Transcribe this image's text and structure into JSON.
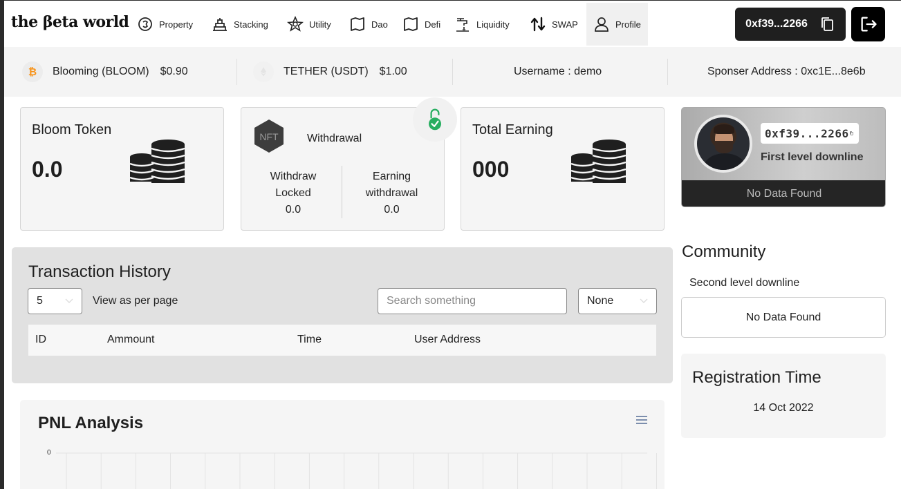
{
  "nav": {
    "logo": "the βeta world",
    "items": [
      {
        "label": "Property",
        "icon": "coin-stack-icon"
      },
      {
        "label": "Stacking",
        "icon": "bricks-icon"
      },
      {
        "label": "Utility",
        "icon": "star-network-icon"
      },
      {
        "label": "Dao",
        "icon": "map-icon"
      },
      {
        "label": "Defi",
        "icon": "map-icon"
      },
      {
        "label": "Liquidity",
        "icon": "faucet-icon"
      },
      {
        "label": "SWAP",
        "icon": "swap-arrows-icon"
      },
      {
        "label": "Profile",
        "icon": "user-icon"
      }
    ],
    "wallet_address": "0xf39...2266"
  },
  "ticker": {
    "bloom": {
      "name": "Blooming (BLOOM)",
      "price": "$0.90"
    },
    "usdt": {
      "name": "TETHER (USDT)",
      "price": "$1.00"
    },
    "username": "Username : demo",
    "sponsor": "Sponser Address : 0xc1E...8e6b"
  },
  "cards": {
    "bloom_token": {
      "title": "Bloom Token",
      "value": "0.0"
    },
    "withdrawal": {
      "badge": "NFT",
      "title": "Withdrawal",
      "locked_label_1": "Withdraw",
      "locked_label_2": "Locked",
      "locked_value": "0.0",
      "earning_label_1": "Earning",
      "earning_label_2": "withdrawal",
      "earning_value": "0.0"
    },
    "total_earning": {
      "title": "Total Earning",
      "value": "000"
    }
  },
  "profile": {
    "address": "0xf39...2266",
    "first_level": "First level downline",
    "no_data": "No Data Found"
  },
  "community": {
    "title": "Community",
    "second_level": "Second level downline",
    "no_data": "No Data Found"
  },
  "registration": {
    "title": "Registration Time",
    "date": "14 Oct 2022"
  },
  "transactions": {
    "title": "Transaction History",
    "per_page_value": "5",
    "per_page_label": "View as per page",
    "search_placeholder": "Search something",
    "filter_value": "None",
    "columns": [
      "ID",
      "Ammount",
      "Time",
      "User Address"
    ]
  },
  "pnl": {
    "title": "PNL Analysis",
    "y_tick": "0"
  },
  "colors": {
    "accent_dark": "#1f1f1f",
    "bitcoin_orange": "#f7931a",
    "lock_green": "#27ae60",
    "panel_gray": "#e1e1e1"
  }
}
